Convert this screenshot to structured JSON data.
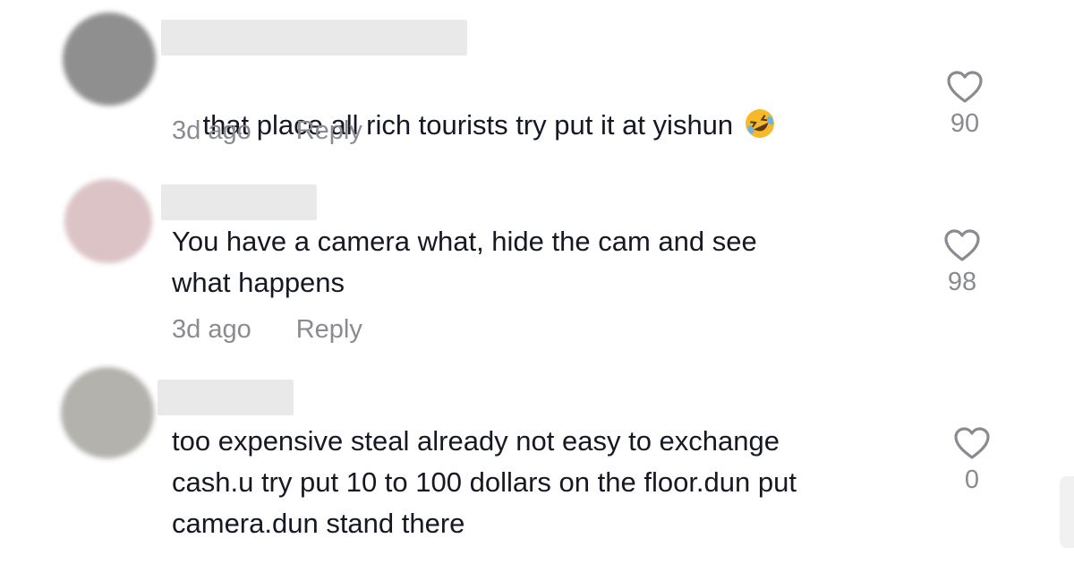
{
  "comments": [
    {
      "avatar_color": "#8f8f8f",
      "text": "that place all rich tourists try put it at yishun",
      "emoji": "rolling-on-floor-laughing-emoji",
      "time": "3d ago",
      "reply_label": "Reply",
      "likes": "90"
    },
    {
      "avatar_color": "#dcc3c6",
      "text": "You have a camera what, hide the cam and see\nwhat happens",
      "time": "3d ago",
      "reply_label": "Reply",
      "likes": "98"
    },
    {
      "avatar_color": "#b3b2ad",
      "text": "too expensive steal already not easy to exchange\ncash.u try put 10 to 100 dollars on the floor.dun put\ncamera.dun stand there",
      "likes": "0"
    }
  ],
  "colors": {
    "text": "#161823",
    "meta": "#8a8b91",
    "heart": "#8a8b91"
  },
  "icons": {
    "like": "heart-outline-icon"
  }
}
